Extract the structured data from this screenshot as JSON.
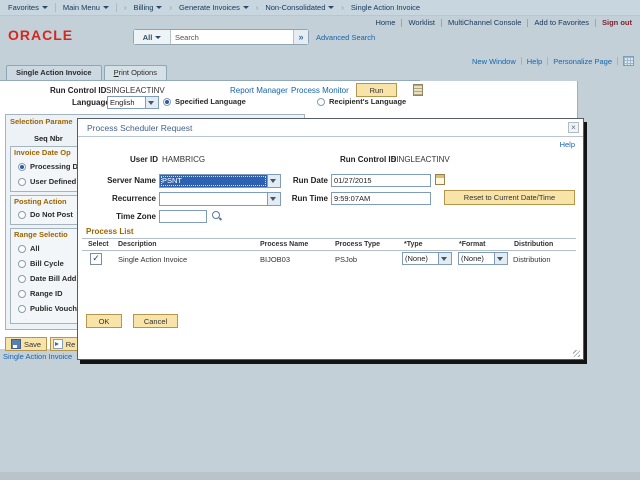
{
  "icons": {
    "close": "×",
    "search_go": "»",
    "check": "✓"
  },
  "colors": {
    "oracle_red": "#d3281e",
    "link_blue": "#1464ae",
    "accent_tan": "#f8e3a9",
    "selection_blue": "#2e62b1",
    "section_orange": "#9c6500"
  },
  "breadcrumb": {
    "items": [
      {
        "label": "Favorites"
      },
      {
        "label": "Main Menu"
      },
      {
        "label": "Billing"
      },
      {
        "label": "Generate Invoices"
      },
      {
        "label": "Non-Consolidated"
      },
      {
        "label": "Single Action Invoice"
      }
    ]
  },
  "header": {
    "brand": "ORACLE",
    "links": [
      {
        "label": "Home"
      },
      {
        "label": "Worklist"
      },
      {
        "label": "MultiChannel Console"
      },
      {
        "label": "Add to Favorites"
      }
    ],
    "signout": "Sign out",
    "search": {
      "scope": "All",
      "query": "Search",
      "advanced": "Advanced Search"
    }
  },
  "utility": {
    "links": [
      {
        "label": "New Window"
      },
      {
        "label": "Help"
      },
      {
        "label": "Personalize Page"
      }
    ]
  },
  "tabs": {
    "items": [
      {
        "label": "Single Action Invoice"
      },
      {
        "label": "Print Options"
      }
    ]
  },
  "page": {
    "run_control_label": "Run Control ID",
    "run_control_value": "SINGLEACTINV",
    "report_manager": "Report Manager",
    "process_monitor": "Process Monitor",
    "run_label": "Run",
    "language_label": "Language",
    "language_value": "English",
    "specified_language": "Specified Language",
    "recipients_language": "Recipient's Language"
  },
  "sidebar": {
    "title": "Selection Parame",
    "seq_label": "Seq Nbr",
    "group1": {
      "title": "Invoice Date Op",
      "opt1": "Processing D",
      "opt2": "User Defined"
    },
    "group2": {
      "title": "Posting Action",
      "opt1": "Do Not Post"
    },
    "group3": {
      "title": "Range Selectio",
      "opt1": "All",
      "opt2": "Bill Cycle",
      "opt3": "Date Bill Add",
      "opt4": "Range ID",
      "opt5": "Public Vouch"
    },
    "save_label": "Save",
    "return_label": "Re"
  },
  "footer": {
    "related_link": "Single Action Invoice"
  },
  "modal": {
    "title": "Process Scheduler Request",
    "help": "Help",
    "user_id_label": "User ID",
    "user_id_value": "HAMBRICG",
    "run_control_label": "Run Control ID",
    "run_control_value": "SINGLEACTINV",
    "server_label": "Server Name",
    "server_value": "PSNT",
    "recurrence_label": "Recurrence",
    "timezone_label": "Time Zone",
    "run_date_label": "Run Date",
    "run_date_value": "01/27/2015",
    "run_time_label": "Run Time",
    "run_time_value": "9:59:07AM",
    "reset_label": "Reset to Current Date/Time",
    "process_list_title": "Process List",
    "grid": {
      "col_select": "Select",
      "col_description": "Description",
      "col_process_name": "Process Name",
      "col_process_type": "Process Type",
      "col_type": "*Type",
      "col_format": "*Format",
      "col_distribution": "Distribution",
      "row": {
        "description": "Single Action Invoice",
        "process_name": "BIJOB03",
        "process_type": "PSJob",
        "type_value": "(None)",
        "format_value": "(None)",
        "distribution": "Distribution"
      }
    },
    "ok_label": "OK",
    "cancel_label": "Cancel"
  }
}
